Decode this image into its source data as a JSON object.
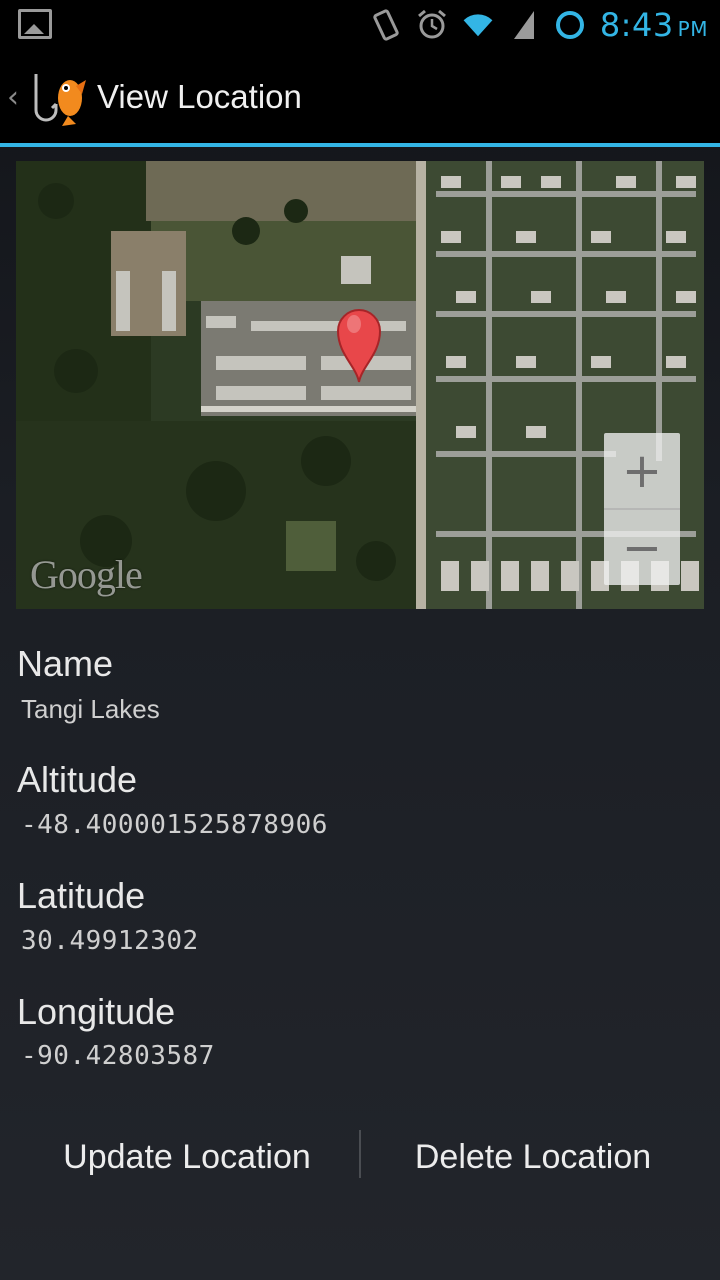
{
  "status_bar": {
    "time": "8:43",
    "ampm": "PM",
    "icons": [
      "gallery-icon",
      "vibrate-icon",
      "alarm-icon",
      "wifi-icon",
      "signal-icon",
      "sync-icon"
    ],
    "accent_color": "#33b5e5"
  },
  "action_bar": {
    "back_glyph": "‹",
    "title": "View Location",
    "logo": "fish-hook-logo"
  },
  "map": {
    "provider_logo": "Google",
    "zoom_in": "+",
    "zoom_out": "−",
    "marker_icon": "map-pin-icon",
    "marker_color": "#e8474a"
  },
  "fields": {
    "name_label": "Name",
    "name_value": "Tangi Lakes",
    "altitude_label": "Altitude",
    "altitude_value": "-48.400001525878906",
    "latitude_label": "Latitude",
    "latitude_value": "30.49912302",
    "longitude_label": "Longitude",
    "longitude_value": "-90.42803587"
  },
  "buttons": {
    "update_label": "Update Location",
    "delete_label": "Delete Location"
  }
}
